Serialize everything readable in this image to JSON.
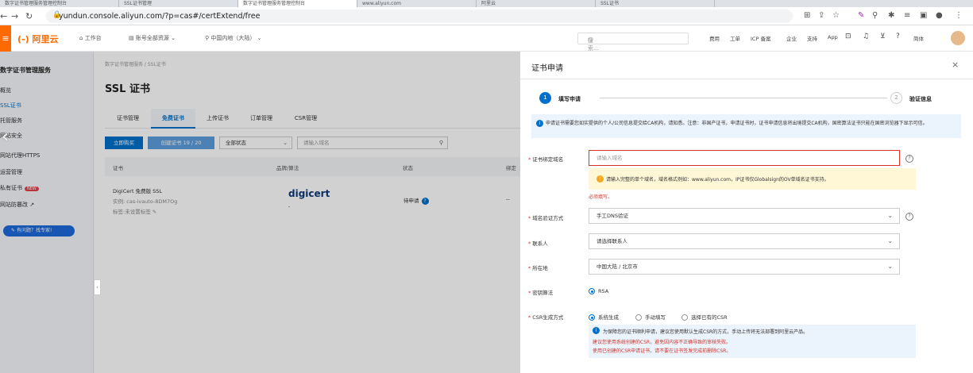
{
  "browser": {
    "tabs": [
      "数字证书管理服务管理控制台",
      "SSL证书管理",
      "数字证书管理服务管理控制台",
      "www.aliyun.com",
      "阿里云",
      "SSL证书"
    ],
    "url": "yundun.console.aliyun.com/?p=cas#/certExtend/free"
  },
  "topbar": {
    "logo": "(-) 阿里云",
    "workbench": "工作台",
    "account": "账号全部资源",
    "region": "中国内地（大陆）",
    "search_placeholder": "搜索...",
    "right_items": [
      "费用",
      "工单",
      "ICP 备案",
      "企业",
      "支持",
      "App"
    ],
    "lang": "简体"
  },
  "sidebar": {
    "title": "数字证书管理服务",
    "items": [
      "概览",
      "SSL证书",
      "托管服务",
      "网站安全",
      "网站代理HTTPS",
      "运营管理",
      "私有证书",
      "网站防篡改"
    ],
    "new_badge": "NEW",
    "help_button": "有问题？找专家!"
  },
  "main": {
    "breadcrumb": "数字证书管理服务 / SSL证书",
    "title": "SSL 证书",
    "tabs": [
      "证书管理",
      "免费证书",
      "上传证书",
      "订单管理",
      "CSR管理"
    ],
    "buy_button": "立即购买",
    "create_button": "创建证书 19 / 20",
    "status_select": "全部状态",
    "domain_placeholder": "请输入域名",
    "table_headers": [
      "证书",
      "品牌/算法",
      "状态",
      "绑定"
    ],
    "row": {
      "cert_name": "DigiCert 免费版 SSL",
      "instance": "实例: cas-ivauto-8DM7Og",
      "tag": "标签:未设置标签",
      "brand": "digicert",
      "brand_sub": "-",
      "status": "待申请",
      "bind": "--"
    }
  },
  "drawer": {
    "title": "证书申请",
    "step1_num": "1",
    "step1": "填写申请",
    "step2_num": "2",
    "step2": "验证信息",
    "notice": "申请证书需要您如实提供的个人/公司信息提交给CA机构，请知悉。注意：非国产证书，申请证书时，证书申请信息将出境提交CA机构，国密算法证书只能在国密浏览器下显示可信。",
    "domain_label": "证书绑定域名",
    "domain_placeholder": "请输入域名",
    "domain_tip": "请输入完整的单个域名，域名格式例如：www.aliyun.com，IP证书仅Globalsign的OV单域名证书支持。",
    "domain_error": "必须填写。",
    "verify_label": "域名验证方式",
    "verify_value": "手工DNS验证",
    "contact_label": "联系人",
    "contact_placeholder": "请选择联系人",
    "location_label": "所在地",
    "location_value": "中国大陆 / 北京市",
    "algo_label": "密钥算法",
    "algo_value": "RSA",
    "csr_label": "CSR生成方式",
    "csr_options": [
      "系统生成",
      "手动填写",
      "选择已有的CSR"
    ],
    "csr_note1": "为保障您的证书顺利申请，建议您使用默认生成CSR的方式，手动上传将无法部署到阿里云产品。",
    "csr_note2": "建议您使用系统创建的CSR，避免因内容不正确导致的审核失败。",
    "csr_note3": "使用已创建的CSR申请证书，请不要在证书签发完成前删除CSR。"
  }
}
